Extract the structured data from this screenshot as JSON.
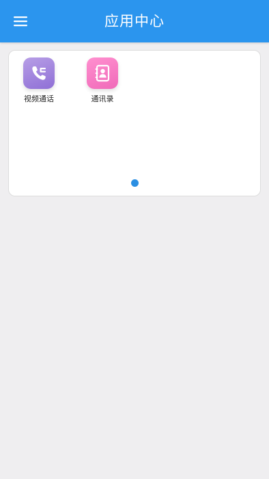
{
  "header": {
    "title": "应用中心",
    "background_color": "#2b95ee",
    "menu_icon": "hamburger-menu-icon"
  },
  "apps": [
    {
      "label": "视频通话",
      "icon": "phone-icon",
      "gradient_start": "#b79ee6",
      "gradient_end": "#8f6fd6"
    },
    {
      "label": "通讯录",
      "icon": "contacts-book-icon",
      "gradient_start": "#ff8fcf",
      "gradient_end": "#f06ab9"
    }
  ],
  "pager": {
    "total_pages": 1,
    "active_page": 1,
    "active_color": "#2b8fe3"
  }
}
